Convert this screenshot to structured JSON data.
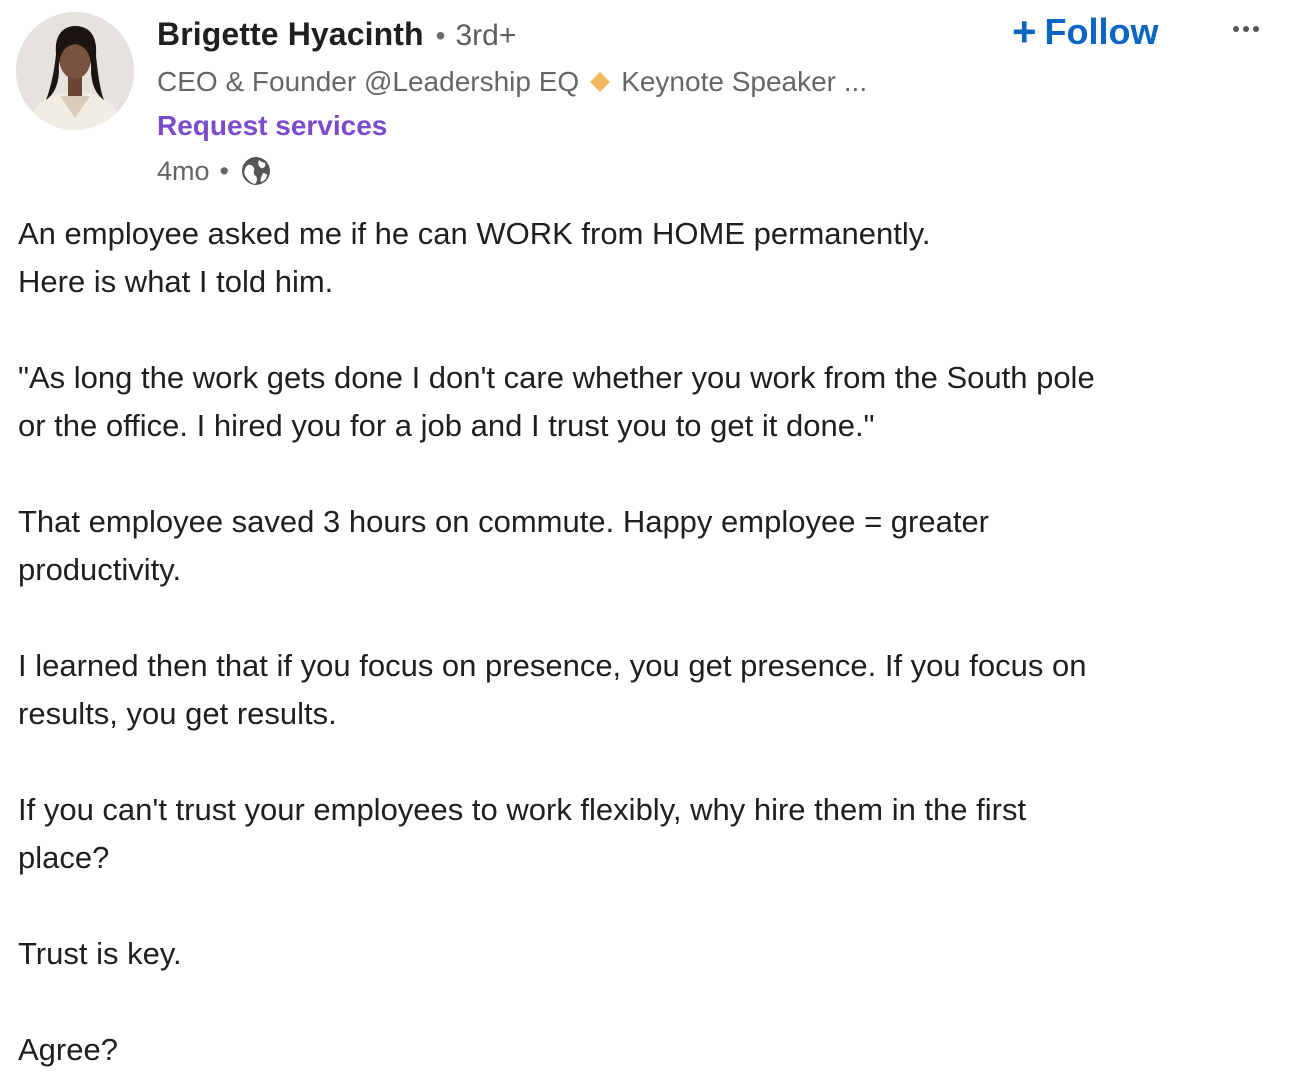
{
  "post": {
    "author": {
      "name": "Brigette Hyacinth",
      "degree": "3rd+",
      "headline_left": "CEO & Founder @Leadership EQ",
      "headline_right": "Keynote Speaker ...",
      "request_services": "Request services",
      "time_ago": "4mo",
      "visibility_icon": "globe-icon"
    },
    "actions": {
      "follow_plus": "+",
      "follow_label": "Follow",
      "more_icon": "more-horizontal-icon"
    },
    "paragraphs": [
      {
        "lines": [
          "An employee asked me if he can WORK from HOME permanently.",
          "Here is what I told him."
        ]
      },
      {
        "lines": [
          "\"As long the work gets done I don't care whether you work from the South pole",
          "or the office. I hired you for a job and I trust you to get it done.\""
        ]
      },
      {
        "lines": [
          "That employee saved 3 hours on commute. Happy employee = greater",
          "productivity."
        ]
      },
      {
        "lines": [
          "I learned then that if you focus on presence, you get presence. If you focus on",
          "results, you get results."
        ]
      },
      {
        "lines": [
          "If you can't trust your employees to work flexibly, why hire them in the first",
          "place?"
        ]
      },
      {
        "lines": [
          "Trust is key."
        ]
      },
      {
        "lines": [
          "Agree?"
        ]
      }
    ]
  },
  "colors": {
    "follow_blue": "#0a66c2",
    "request_purple": "#7b4bcc",
    "diamond_orange": "#f3b75e"
  }
}
